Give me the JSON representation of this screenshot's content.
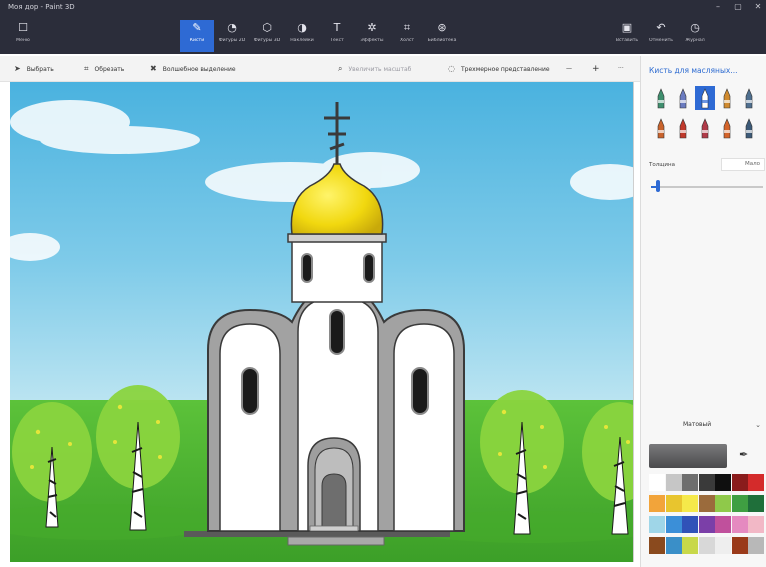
{
  "window": {
    "title": "Моя дор - Paint 3D",
    "controls": [
      "–",
      "▢",
      "✕"
    ]
  },
  "ribbon": {
    "menu": {
      "label": "Меню",
      "icon": "menu-icon"
    },
    "tools": [
      {
        "label": "Кисти",
        "icon": "brush-icon",
        "active": true
      },
      {
        "label": "Фигуры 2D",
        "icon": "shapes-2d-icon",
        "active": false
      },
      {
        "label": "Фигуры 3D",
        "icon": "shapes-3d-icon",
        "active": false
      },
      {
        "label": "Наклейки",
        "icon": "stickers-icon",
        "active": false
      },
      {
        "label": "Текст",
        "icon": "text-icon",
        "active": false
      },
      {
        "label": "Эффекты",
        "icon": "effects-icon",
        "active": false
      },
      {
        "label": "Холст",
        "icon": "canvas-icon",
        "active": false
      },
      {
        "label": "Библиотека",
        "icon": "library-icon",
        "active": false
      }
    ],
    "right": [
      {
        "label": "Вставить",
        "icon": "paste-icon"
      },
      {
        "label": "Отменить",
        "icon": "undo-icon"
      },
      {
        "label": "Журнал",
        "icon": "history-icon"
      }
    ]
  },
  "toolbar": {
    "select": "Выбрать",
    "crop": "Обрезать",
    "magic_select": "Волшебное выделение",
    "zoom_hint": "Увеличить масштаб",
    "mixed_reality": "Трехмерное представление",
    "zoom_out": "—",
    "zoom_in": "+",
    "more": "···"
  },
  "panel": {
    "title": "Кисть для масляных...",
    "brushes": [
      {
        "name": "marker",
        "color": "#3f8f6e",
        "selected": false
      },
      {
        "name": "calligraphy-pen",
        "color": "#6a7bc0",
        "selected": false
      },
      {
        "name": "oil-brush",
        "color": "#2e6ad4",
        "selected": true
      },
      {
        "name": "watercolor",
        "color": "#d08a2e",
        "selected": false
      },
      {
        "name": "pixel-pen",
        "color": "#4f6f8f",
        "selected": false
      },
      {
        "name": "pencil",
        "color": "#c9632c",
        "selected": false
      },
      {
        "name": "eraser",
        "color": "#c0392b",
        "selected": false
      },
      {
        "name": "crayon",
        "color": "#b03a48",
        "selected": false
      },
      {
        "name": "spray-can",
        "color": "#d4642a",
        "selected": false
      },
      {
        "name": "fill",
        "color": "#3c5a78",
        "selected": false
      }
    ],
    "thickness_label": "Толщина",
    "thickness_value": "Мало",
    "thickness_level": 0.06,
    "finish": "Матовый",
    "current_color": "#4a4a4c",
    "palette": [
      "#ffffff",
      "#c6c6c6",
      "#6e6e6e",
      "#3a3a3a",
      "#0f0f0f",
      "#8a1c1c",
      "#d42b2b",
      "#f2a43a",
      "#e8c52e",
      "#f5e94a",
      "#9b6b3c",
      "#8fc94a",
      "#3f9f42",
      "#1f6f3a",
      "#9fd6e8",
      "#3b8fd8",
      "#3052b8",
      "#7b3fa8",
      "#c0509c",
      "#e58ac0",
      "#f2b8c6",
      "#8a4a1e",
      "#3a8fc8",
      "#c8d84a",
      "#d8d8d8",
      "#eeeeee",
      "#9a3a1a",
      "#b8b8b8"
    ]
  }
}
